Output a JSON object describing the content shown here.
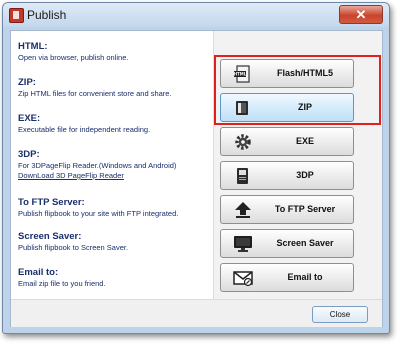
{
  "window": {
    "title": "Publish"
  },
  "items": [
    {
      "heading": "HTML:",
      "desc": "Open via browser, publish online."
    },
    {
      "heading": "ZIP:",
      "desc": "Zip HTML files for convenient store and share."
    },
    {
      "heading": "EXE:",
      "desc": "Executable file for independent reading."
    },
    {
      "heading": "3DP:",
      "desc": "For 3DPageFlip Reader.(Windows and Android)",
      "link": "DownLoad 3D PageFlip Reader"
    },
    {
      "heading": "To FTP Server:",
      "desc": "Publish flipbook to your site with FTP integrated."
    },
    {
      "heading": "Screen Saver:",
      "desc": "Publish flipbook to Screen Saver."
    },
    {
      "heading": "Email to:",
      "desc": "Email zip file to you friend."
    }
  ],
  "buttons": [
    {
      "label": "Flash/HTML5",
      "icon": "html5-document-icon"
    },
    {
      "label": "ZIP",
      "icon": "zip-archive-icon"
    },
    {
      "label": "EXE",
      "icon": "gear-icon"
    },
    {
      "label": "3DP",
      "icon": "3dp-book-icon"
    },
    {
      "label": "To FTP Server",
      "icon": "upload-arrow-icon"
    },
    {
      "label": "Screen Saver",
      "icon": "monitor-icon"
    },
    {
      "label": "Email to",
      "icon": "envelope-icon"
    }
  ],
  "footer": {
    "close_label": "Close"
  },
  "colors": {
    "highlight": "#e0201a",
    "text": "#1a2f6b",
    "active_button": "#cfe7f8"
  }
}
